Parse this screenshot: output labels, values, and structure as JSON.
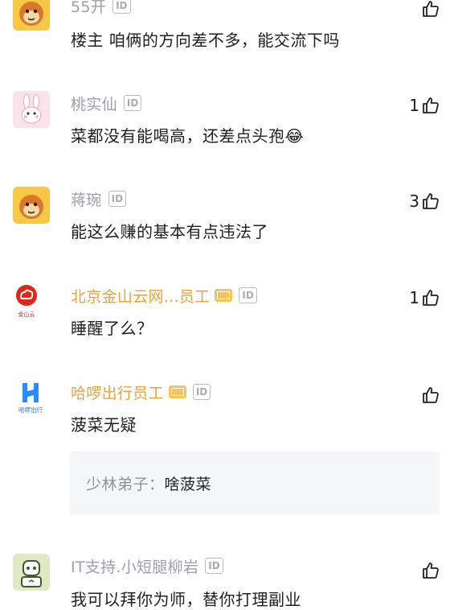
{
  "comments": [
    {
      "username": "55开",
      "id_badge": "ID",
      "text": "楼主 咱俩的方向差不多，能交流下吗",
      "likes": "",
      "avatar": "orange-monkey-avatar"
    },
    {
      "username": "桃实仙",
      "id_badge": "ID",
      "text": "菜都没有能喝高，还差点头孢😂",
      "likes": "1",
      "avatar": "pink-rabbit-avatar"
    },
    {
      "username": "蒋琬",
      "id_badge": "ID",
      "text": "能这么赚的基本有点违法了",
      "likes": "3",
      "avatar": "orange-monkey-avatar"
    },
    {
      "username": "北京金山云网...员工",
      "id_badge": "ID",
      "text": "睡醒了么？",
      "likes": "1",
      "avatar": "kingsoft-cloud-logo",
      "avatar_caption": "金山云"
    },
    {
      "username": "哈啰出行员工",
      "id_badge": "ID",
      "text": "菠菜无疑",
      "likes": "",
      "avatar": "hellobike-logo",
      "avatar_caption": "哈啰出行",
      "reply": {
        "user": "少林弟子：",
        "text": "啥菠菜"
      }
    },
    {
      "username": "IT支持.小短腿柳岩",
      "id_badge": "ID",
      "text": "我可以拜你为师，替你打理副业",
      "likes": "",
      "avatar": "green-robot-avatar"
    }
  ],
  "colors": {
    "name_gray": "#9aa0a6",
    "name_vip": "#e8a33d",
    "reply_bg": "#f5f6f7"
  }
}
